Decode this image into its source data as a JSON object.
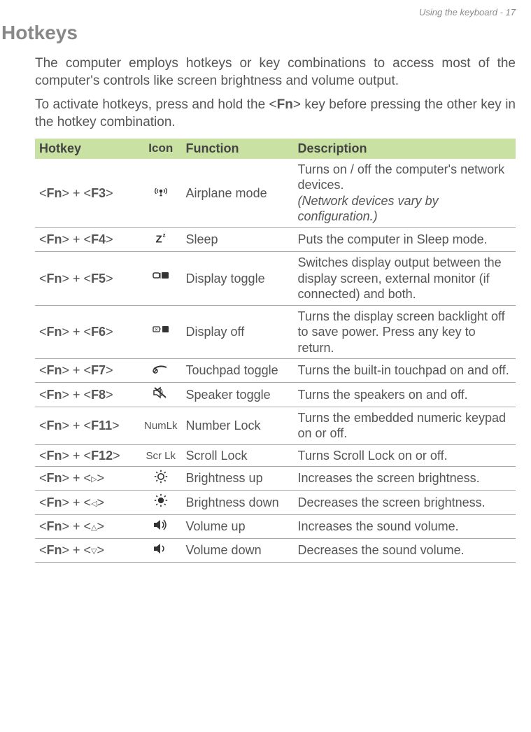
{
  "header": "Using the keyboard - 17",
  "title": "Hotkeys",
  "intro": {
    "p1": "The computer employs hotkeys or key combinations to access most of the computer's controls like screen brightness and volume output.",
    "p2_pre": "To activate hotkeys, press and hold the <",
    "p2_bold": "Fn",
    "p2_post": "> key before pressing the other key in the hotkey combination."
  },
  "columns": {
    "hotkey": "Hotkey",
    "icon": "Icon",
    "function": "Function",
    "description": "Description"
  },
  "rows": [
    {
      "key_bold1": "Fn",
      "key_bold2": "F3",
      "key_arrow": "",
      "icon": "airplane",
      "function": "Airplane mode",
      "desc": "Turns on / off the computer's network devices.",
      "desc_italic": "(Network devices vary by configuration.)"
    },
    {
      "key_bold1": "Fn",
      "key_bold2": "F4",
      "key_arrow": "",
      "icon": "sleep",
      "function": "Sleep",
      "desc": "Puts the computer in Sleep mode."
    },
    {
      "key_bold1": "Fn",
      "key_bold2": "F5",
      "key_arrow": "",
      "icon": "display-toggle",
      "function": "Display toggle",
      "desc": "Switches display output between the display screen, external monitor (if connected) and both."
    },
    {
      "key_bold1": "Fn",
      "key_bold2": "F6",
      "key_arrow": "",
      "icon": "display-off",
      "function": "Display off",
      "desc": "Turns the display screen backlight off to save power. Press any key to return."
    },
    {
      "key_bold1": "Fn",
      "key_bold2": "F7",
      "key_arrow": "",
      "icon": "touchpad",
      "function": "Touchpad toggle",
      "desc": "Turns the built-in touchpad on and off."
    },
    {
      "key_bold1": "Fn",
      "key_bold2": "F8",
      "key_arrow": "",
      "icon": "speaker-mute",
      "function": "Speaker toggle",
      "desc": "Turns the speakers on and off."
    },
    {
      "key_bold1": "Fn",
      "key_bold2": "F11",
      "key_arrow": "",
      "icon_text": "NumLk",
      "function": "Number Lock",
      "desc": "Turns the embedded numeric keypad on or off."
    },
    {
      "key_bold1": "Fn",
      "key_bold2": "F12",
      "key_arrow": "",
      "icon_text": "Scr Lk",
      "function": "Scroll Lock",
      "desc": "Turns Scroll Lock on or off."
    },
    {
      "key_bold1": "Fn",
      "key_bold2": "",
      "key_arrow": "▷",
      "icon": "brightness-up",
      "function": "Brightness up",
      "desc": "Increases the screen brightness."
    },
    {
      "key_bold1": "Fn",
      "key_bold2": "",
      "key_arrow": "◁",
      "icon": "brightness-down",
      "function": "Brightness down",
      "desc": "Decreases the screen brightness."
    },
    {
      "key_bold1": "Fn",
      "key_bold2": "",
      "key_arrow": "△",
      "icon": "volume-up",
      "function": "Volume up",
      "desc": "Increases the sound volume."
    },
    {
      "key_bold1": "Fn",
      "key_bold2": "",
      "key_arrow": "▽",
      "icon": "volume-down",
      "function": "Volume down",
      "desc": "Decreases the sound volume."
    }
  ]
}
